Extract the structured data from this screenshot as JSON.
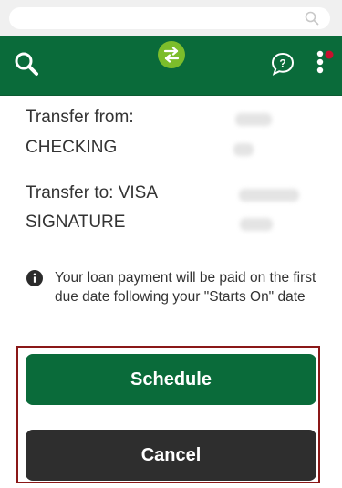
{
  "transfer": {
    "from_label_line1": "Transfer from:",
    "from_label_line2": "CHECKING",
    "to_label_line1": "Transfer to: VISA",
    "to_label_line2": "SIGNATURE"
  },
  "info": {
    "message": "Your loan payment will be paid on the first due date following your \"Starts On\" date"
  },
  "actions": {
    "schedule_label": "Schedule",
    "cancel_label": "Cancel"
  },
  "colors": {
    "brand_green": "#0a6b3a",
    "accent_green": "#7cbd2b",
    "notification_dot": "#c8102e",
    "cancel_button": "#2e2e2e",
    "focus_outline": "#8a1818"
  }
}
